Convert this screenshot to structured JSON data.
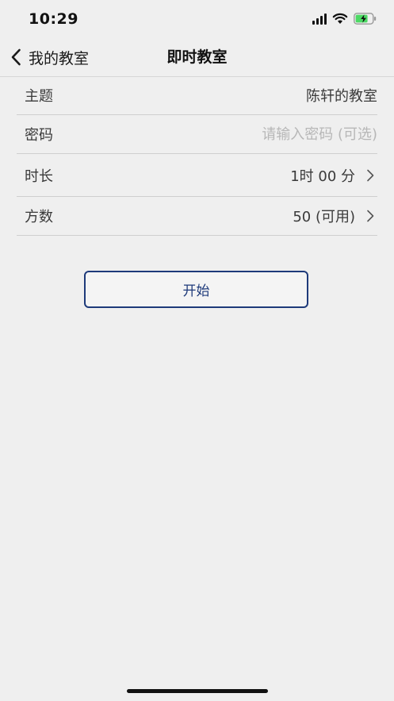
{
  "status_bar": {
    "time": "10:29",
    "icons": [
      "signal-icon",
      "wifi-icon",
      "battery-charging-icon"
    ],
    "battery_color": "#4cd964"
  },
  "nav": {
    "back_label": "我的教室",
    "title": "即时教室"
  },
  "form": {
    "topic": {
      "label": "主题",
      "value": "陈轩的教室"
    },
    "password": {
      "label": "密码",
      "value": "",
      "placeholder": "请输入密码 (可选)"
    },
    "duration": {
      "label": "时长",
      "value": "1时 00 分"
    },
    "participants": {
      "label": "方数",
      "value": "50 (可用)"
    }
  },
  "start_button": {
    "label": "开始"
  },
  "colors": {
    "accent": "#1e3a7a",
    "background": "#efefef",
    "divider": "#cfcfcf"
  }
}
